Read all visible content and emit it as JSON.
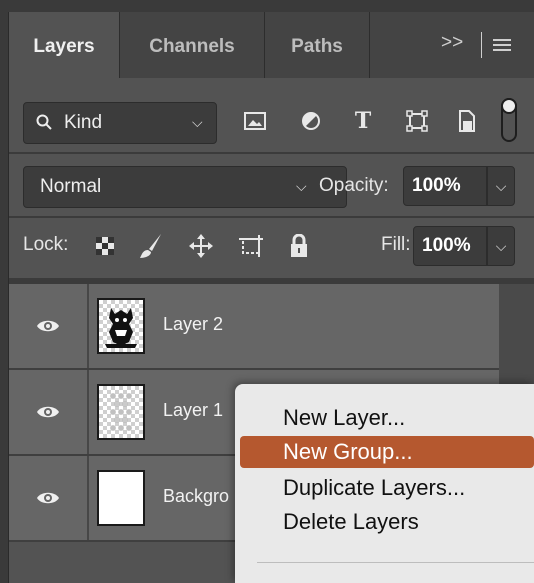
{
  "tabs": [
    {
      "label": "Layers",
      "active": true
    },
    {
      "label": "Channels",
      "active": false
    },
    {
      "label": "Paths",
      "active": false
    }
  ],
  "tabs_overflow": ">>",
  "filter": {
    "kind_label": "Kind",
    "icons": [
      "image-filter-icon",
      "adjustment-filter-icon",
      "type-filter-icon",
      "shape-filter-icon",
      "smart-object-filter-icon"
    ]
  },
  "blend": {
    "mode": "Normal",
    "opacity_label": "Opacity:",
    "opacity_value": "100%"
  },
  "lock": {
    "label": "Lock:",
    "icons": [
      "lock-transparent-pixels-icon",
      "lock-image-pixels-icon",
      "lock-position-icon",
      "lock-artboard-icon",
      "lock-all-icon"
    ],
    "fill_label": "Fill:",
    "fill_value": "100%"
  },
  "layers": [
    {
      "name": "Layer 2",
      "thumb": "illustration"
    },
    {
      "name": "Layer 1",
      "thumb": "pattern"
    },
    {
      "name": "Backgro",
      "thumb": "white"
    }
  ],
  "context_menu": {
    "items": [
      {
        "label": "New Layer...",
        "highlighted": false
      },
      {
        "label": "New Group...",
        "highlighted": true
      },
      {
        "label": "Duplicate Layers...",
        "highlighted": false
      },
      {
        "label": "Delete Layers",
        "highlighted": false
      }
    ]
  },
  "colors": {
    "panel_bg": "#535353",
    "highlight": "#b5582f",
    "menu_bg": "#e9e9e9"
  }
}
